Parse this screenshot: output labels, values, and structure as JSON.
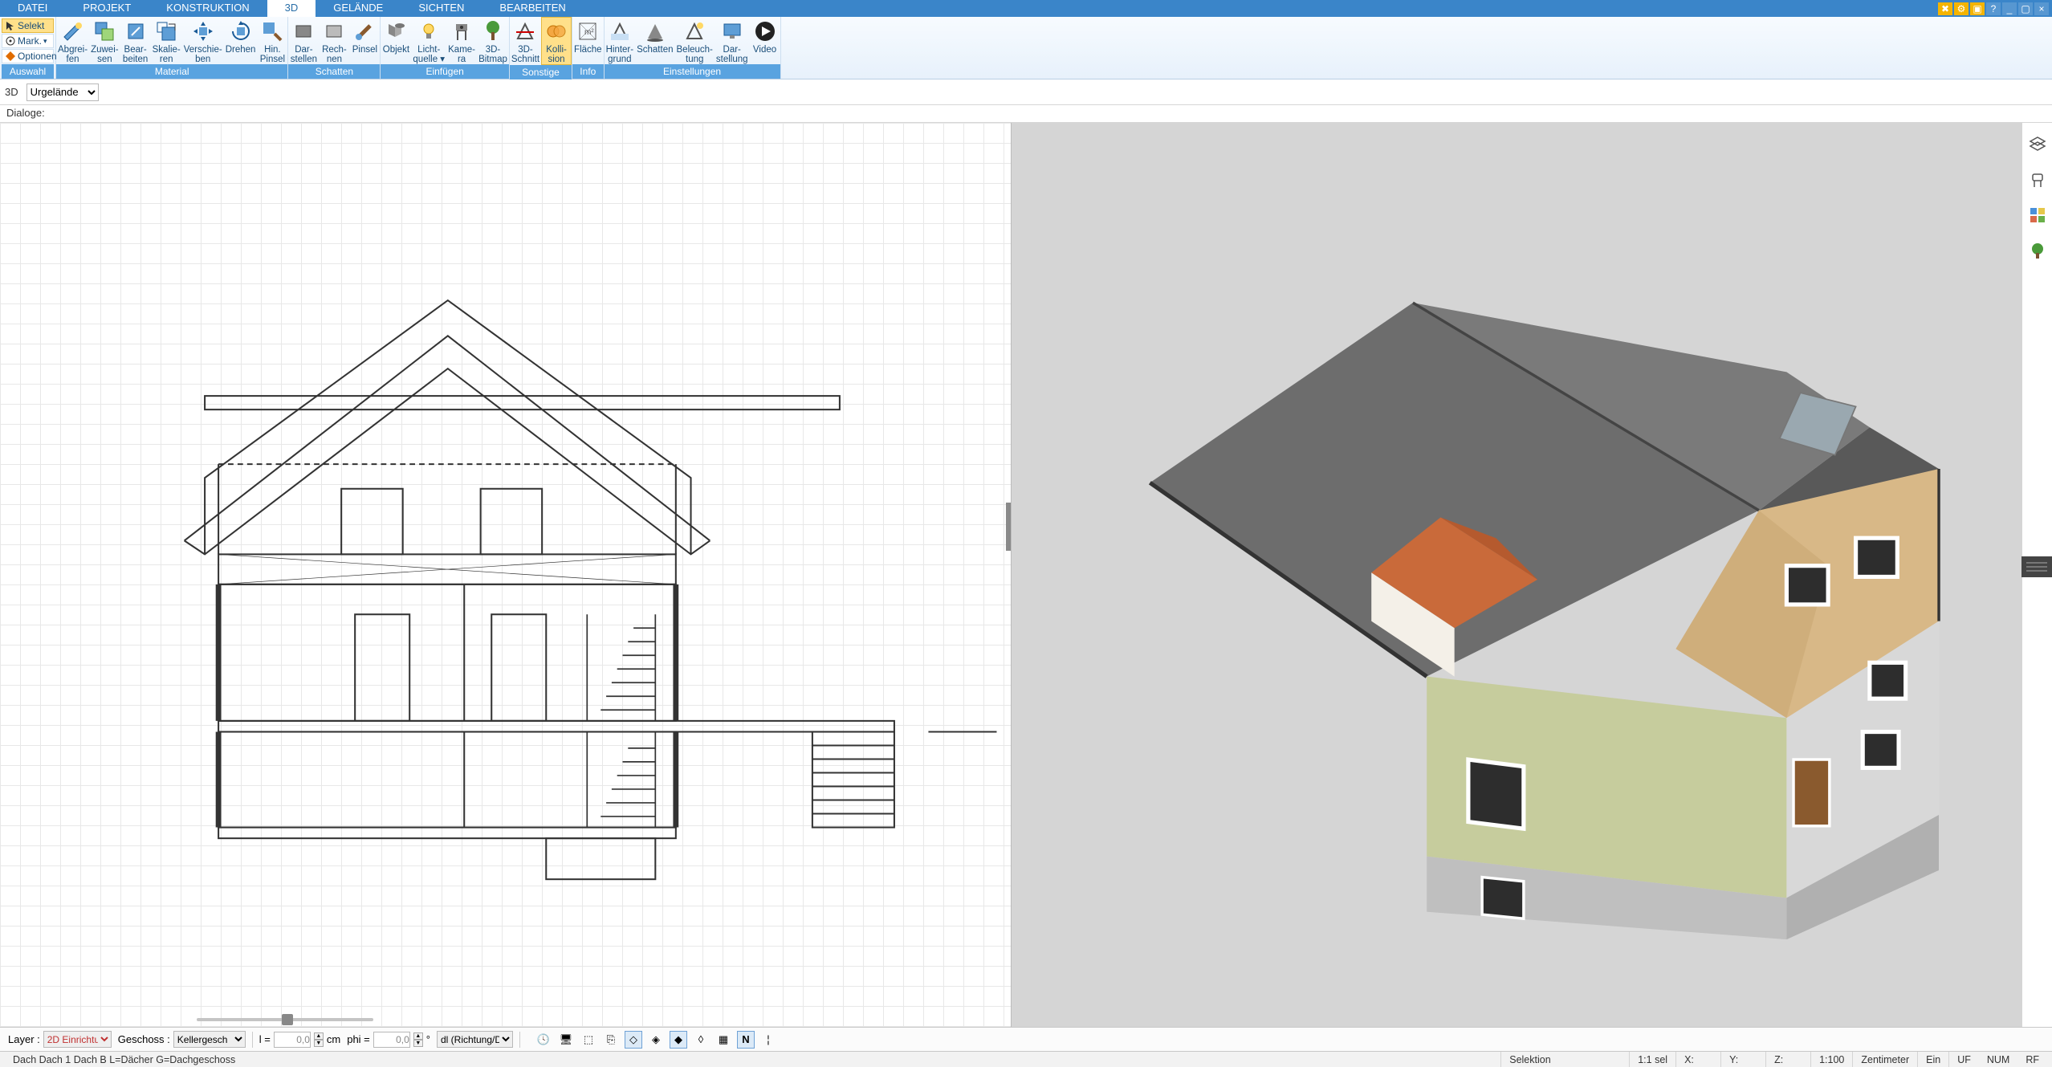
{
  "menubar": {
    "tabs": [
      "DATEI",
      "PROJEKT",
      "KONSTRUKTION",
      "3D",
      "GELÄNDE",
      "SICHTEN",
      "BEARBEITEN"
    ],
    "active_index": 3
  },
  "side_tools": {
    "select": "Selekt",
    "mark": "Mark.",
    "options": "Optionen"
  },
  "ribbon": {
    "groups": [
      {
        "label": "Auswahl",
        "buttons": []
      },
      {
        "label": "Material",
        "buttons": [
          {
            "name": "abgreifen",
            "line1": "Abgrei-",
            "line2": "fen"
          },
          {
            "name": "zuweisen",
            "line1": "Zuwei-",
            "line2": "sen"
          },
          {
            "name": "bearbeiten",
            "line1": "Bear-",
            "line2": "beiten"
          },
          {
            "name": "skalieren",
            "line1": "Skalie-",
            "line2": "ren"
          },
          {
            "name": "verschieben",
            "line1": "Verschie-",
            "line2": "ben"
          },
          {
            "name": "drehen",
            "line1": "Drehen",
            "line2": ""
          },
          {
            "name": "hin-pinsel",
            "line1": "Hin.",
            "line2": "Pinsel"
          }
        ]
      },
      {
        "label": "Schatten",
        "buttons": [
          {
            "name": "darstellen",
            "line1": "Dar-",
            "line2": "stellen"
          },
          {
            "name": "rechnen",
            "line1": "Rech-",
            "line2": "nen"
          },
          {
            "name": "pinsel",
            "line1": "Pinsel",
            "line2": ""
          }
        ]
      },
      {
        "label": "Einfügen",
        "buttons": [
          {
            "name": "objekt",
            "line1": "Objekt",
            "line2": ""
          },
          {
            "name": "lichtquelle",
            "line1": "Licht-",
            "line2": "quelle ▾"
          },
          {
            "name": "kamera",
            "line1": "Kame-",
            "line2": "ra"
          },
          {
            "name": "3d-bitmap",
            "line1": "3D-",
            "line2": "Bitmap"
          }
        ]
      },
      {
        "label": "Sonstige",
        "buttons": [
          {
            "name": "3d-schnitt",
            "line1": "3D-",
            "line2": "Schnitt"
          },
          {
            "name": "kollision",
            "line1": "Kolli-",
            "line2": "sion",
            "active": true
          }
        ]
      },
      {
        "label": "Info",
        "buttons": [
          {
            "name": "flaeche",
            "line1": "Fläche",
            "line2": ""
          }
        ]
      },
      {
        "label": "Einstellungen",
        "buttons": [
          {
            "name": "hintergrund",
            "line1": "Hinter-",
            "line2": "grund"
          },
          {
            "name": "schatten-einst",
            "line1": "Schatten",
            "line2": ""
          },
          {
            "name": "beleuchtung",
            "line1": "Beleuch-",
            "line2": "tung"
          },
          {
            "name": "darstellung",
            "line1": "Dar-",
            "line2": "stellung"
          },
          {
            "name": "video",
            "line1": "Video",
            "line2": ""
          }
        ]
      }
    ]
  },
  "subbar": {
    "mode": "3D",
    "selection": "Urgelände"
  },
  "dialogbar": {
    "label": "Dialoge:"
  },
  "bottom": {
    "layer_label": "Layer :",
    "layer_value": "2D Einrichtu",
    "geschoss_label": "Geschoss :",
    "geschoss_value": "Kellergesch",
    "l_label": "l =",
    "l_value": "0,0",
    "l_unit": "cm",
    "phi_label": "phi =",
    "phi_value": "0,0",
    "dl_value": "dl (Richtung/Di"
  },
  "status": {
    "left": "Dach Dach 1 Dach B L=Dächer G=Dachgeschoss",
    "selection": "Selektion",
    "scale_sel": "1:1 sel",
    "x": "X:",
    "y": "Y:",
    "z": "Z:",
    "scale": "1:100",
    "units": "Zentimeter",
    "ein": "Ein",
    "uf": "UF",
    "num": "NUM",
    "rf": "RF"
  },
  "right_dock": {
    "icons": [
      "layers-icon",
      "chair-icon",
      "palette-icon",
      "tree-icon"
    ]
  }
}
